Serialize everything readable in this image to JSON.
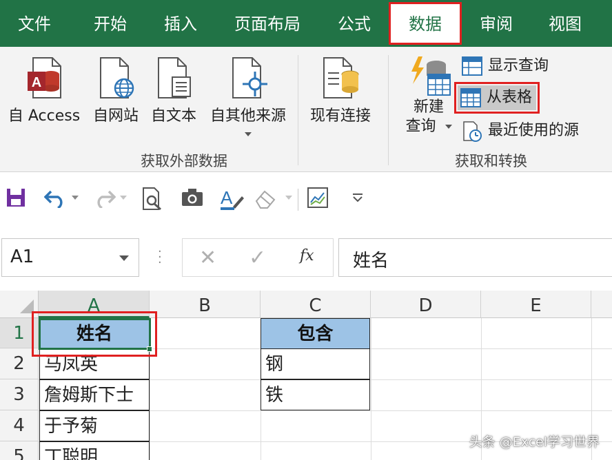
{
  "ribbon_tabs": [
    "文件",
    "开始",
    "插入",
    "页面布局",
    "公式",
    "数据",
    "审阅",
    "视图"
  ],
  "active_tab": "数据",
  "get_external_data": {
    "buttons": [
      "自 Access",
      "自网站",
      "自文本",
      "自其他来源",
      "现有连接"
    ],
    "group_label": "获取外部数据"
  },
  "get_transform": {
    "new_query_line1": "新建",
    "new_query_line2": "查询",
    "show_queries": "显示查询",
    "from_table": "从表格",
    "recent_sources": "最近使用的源",
    "group_label": "获取和转换"
  },
  "formula_bar": {
    "name_box": "A1",
    "fx_label": "fx",
    "formula": "姓名",
    "cancel_glyph": "✕",
    "enter_glyph": "✓"
  },
  "sheet": {
    "columns": [
      "A",
      "B",
      "C",
      "D",
      "E"
    ],
    "rows": [
      "1",
      "2",
      "3",
      "4",
      "5"
    ],
    "col_a": [
      "姓名",
      "马凤英",
      "詹姆斯下士",
      "于予菊",
      "丁聪明"
    ],
    "col_c": [
      "包含",
      "钢",
      "铁"
    ]
  },
  "watermark": "头条 @Excel学习世界",
  "colors": {
    "excel_green": "#217346",
    "highlight_red": "#e02020",
    "header_fill": "#9dc3e6"
  }
}
